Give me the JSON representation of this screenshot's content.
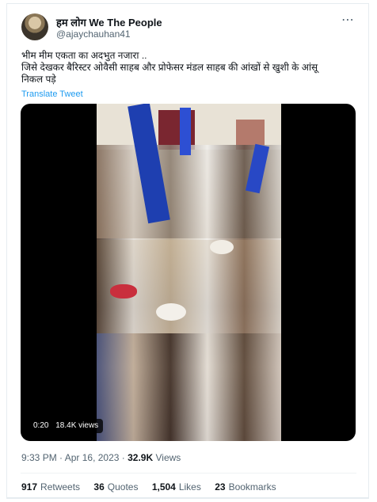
{
  "tweet": {
    "author_name": "हम लोग We The People",
    "author_handle": "@ajaychauhan41",
    "more_icon": "more-horizontal-icon",
    "text_lines": [
      "भीम मीम एकता का अदभुत नजारा ..",
      "जिसे देखकर बैरिस्टर ओवैसी साहब और प्रोफेसर मंडल साहब की आंखों से खुशी के आंसू",
      "निकल पड़े"
    ],
    "translate_label": "Translate Tweet",
    "video": {
      "time": "0:20",
      "views": "18.4K views"
    },
    "meta": {
      "time": "9:33 PM",
      "date": "Apr 16, 2023",
      "views_count": "32.9K",
      "views_label": "Views"
    },
    "stats": [
      {
        "count": "917",
        "label": "Retweets"
      },
      {
        "count": "36",
        "label": "Quotes"
      },
      {
        "count": "1,504",
        "label": "Likes"
      },
      {
        "count": "23",
        "label": "Bookmarks"
      }
    ]
  }
}
